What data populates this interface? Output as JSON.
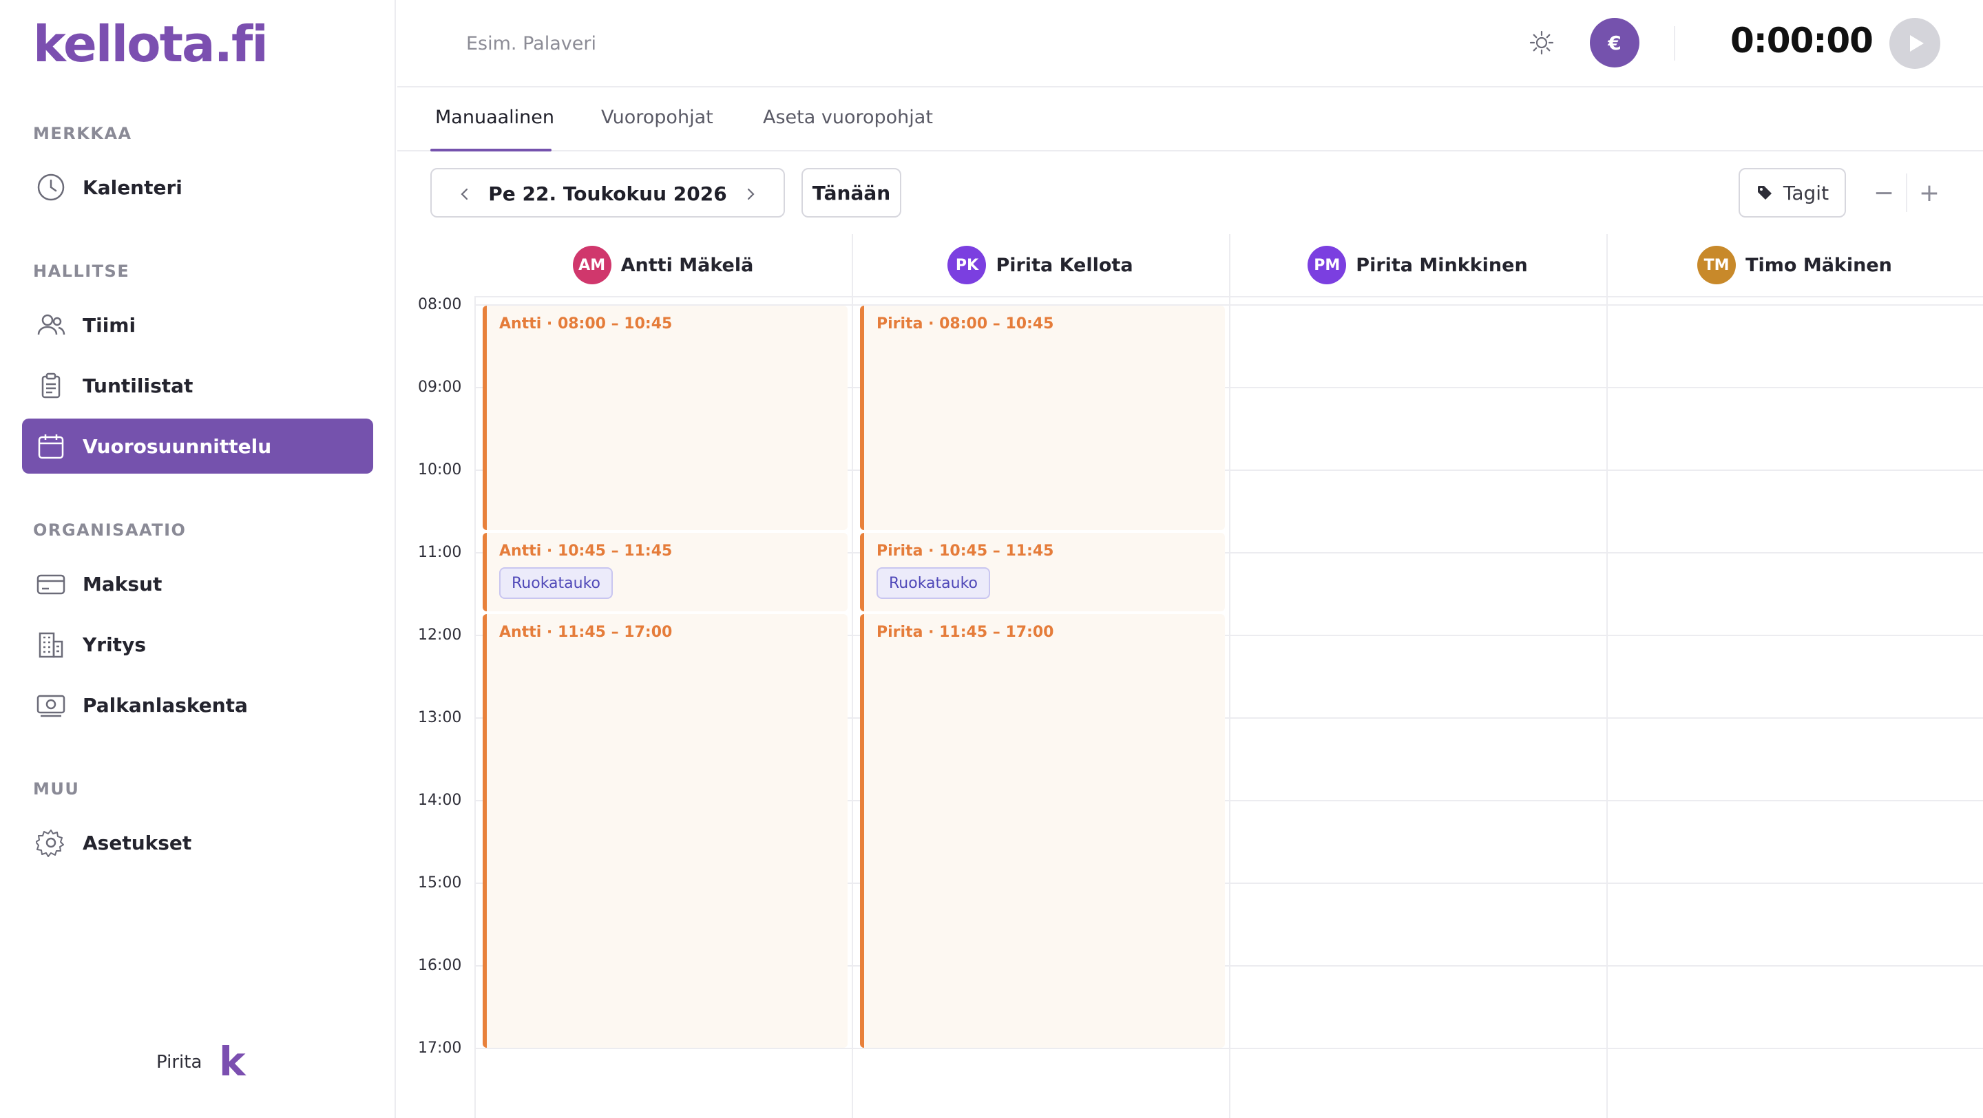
{
  "brand": {
    "logo": "kellota.fi",
    "footer_logo": "k",
    "accent": "#7552ad"
  },
  "sidebar": {
    "sections": [
      {
        "label": "MERKKAA"
      },
      {
        "label": "HALLITSE"
      },
      {
        "label": "ORGANISAATIO"
      },
      {
        "label": "MUU"
      }
    ],
    "items": [
      {
        "label": "Kalenteri",
        "icon": "clock-icon"
      },
      {
        "label": "Tiimi",
        "icon": "users-icon"
      },
      {
        "label": "Tuntilistat",
        "icon": "clipboard-icon"
      },
      {
        "label": "Vuorosuunnittelu",
        "icon": "calendar-icon",
        "active": true
      },
      {
        "label": "Maksut",
        "icon": "credit-card-icon"
      },
      {
        "label": "Yritys",
        "icon": "building-icon"
      },
      {
        "label": "Palkanlaskenta",
        "icon": "money-icon"
      },
      {
        "label": "Asetukset",
        "icon": "gear-icon"
      }
    ],
    "footer_user": "Pirita"
  },
  "topbar": {
    "task_placeholder": "Esim. Palaveri",
    "currency_symbol": "€",
    "timer": "0:00:00"
  },
  "tabs": [
    {
      "label": "Manuaalinen",
      "active": true
    },
    {
      "label": "Vuoropohjat"
    },
    {
      "label": "Aseta vuoropohjat"
    }
  ],
  "controls": {
    "date": "Pe 22. Toukokuu 2026",
    "today_label": "Tänään",
    "tags_label": "Tagit",
    "zoom_out": "−",
    "zoom_in": "+"
  },
  "calendar": {
    "hours": [
      "08:00",
      "09:00",
      "10:00",
      "11:00",
      "12:00",
      "13:00",
      "14:00",
      "15:00",
      "16:00",
      "17:00"
    ],
    "people": [
      {
        "initials": "AM",
        "name": "Antti Mäkelä",
        "color": "#d0376c"
      },
      {
        "initials": "PK",
        "name": "Pirita Kellota",
        "color": "#7b3fe0"
      },
      {
        "initials": "PM",
        "name": "Pirita Minkkinen",
        "color": "#7b3fe0"
      },
      {
        "initials": "TM",
        "name": "Timo Mäkinen",
        "color": "#c8892a"
      }
    ],
    "events": [
      {
        "title": "Antti · 08:00 – 10:45"
      },
      {
        "title": "Antti · 10:45 – 11:45",
        "tag": "Ruokatauko"
      },
      {
        "title": "Antti · 11:45 – 17:00"
      },
      {
        "title": "Pirita · 08:00 – 10:45"
      },
      {
        "title": "Pirita · 10:45 – 11:45",
        "tag": "Ruokatauko"
      },
      {
        "title": "Pirita · 11:45 – 17:00"
      }
    ],
    "event_color": "#e8803a"
  }
}
